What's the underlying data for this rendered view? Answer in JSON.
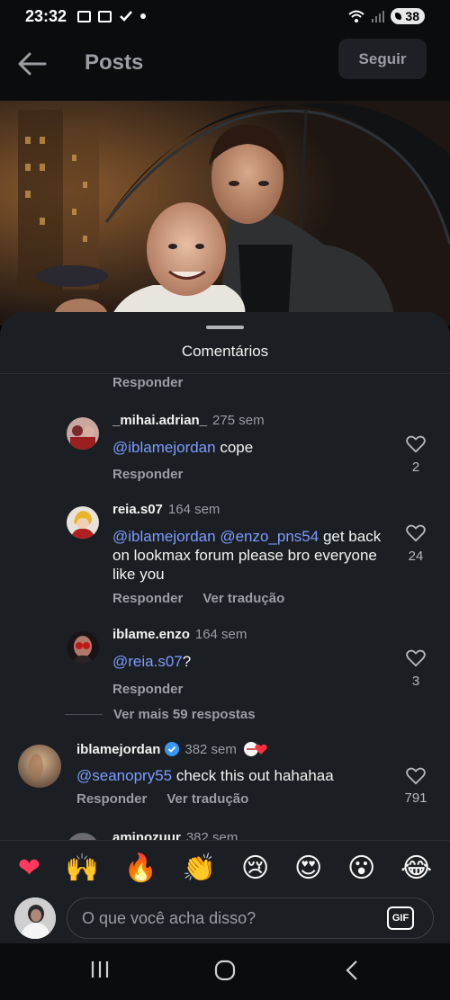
{
  "status_bar": {
    "time": "23:32",
    "battery": "38",
    "icons": [
      "screenshot-icon",
      "calendar-icon",
      "check-icon",
      "wifi-icon",
      "signal-icon",
      "battery-icon"
    ]
  },
  "header": {
    "title": "Posts",
    "follow_label": "Seguir"
  },
  "sheet": {
    "title": "Comentários"
  },
  "actions": {
    "reply": "Responder",
    "translate": "Ver tradução"
  },
  "comments": [
    {
      "username": "_mihai.adrian_",
      "time": "275 sem",
      "mention": "@iblamejordan",
      "text": " cope",
      "likes": "2"
    },
    {
      "username": "reia.s07",
      "time": "164 sem",
      "mention": "@iblamejordan @enzo_pns54",
      "text": " get back on lookmax forum please bro everyone like you",
      "likes": "24"
    },
    {
      "username": "iblame.enzo",
      "time": "164 sem",
      "mention": "@reia.s07",
      "text": "?",
      "likes": "3"
    },
    {
      "username": "iblamejordan",
      "time": "382 sem",
      "verified": true,
      "mention": "@seanopry55",
      "text": " check this out hahahaa",
      "likes": "791"
    },
    {
      "username": "aminozuur",
      "time": "382 sem"
    }
  ],
  "more_replies": "Ver mais 59 respostas",
  "emoji_bar": [
    "❤",
    "🙌",
    "🔥",
    "👏",
    "😢",
    "😍",
    "😮",
    "😂"
  ],
  "input": {
    "placeholder": "O que você acha disso?",
    "gif_label": "GIF"
  },
  "colors": {
    "background": "#1b1e22",
    "mention": "#7c9dff",
    "secondary_text": "#9a9ea4",
    "verified": "#3897f0"
  }
}
